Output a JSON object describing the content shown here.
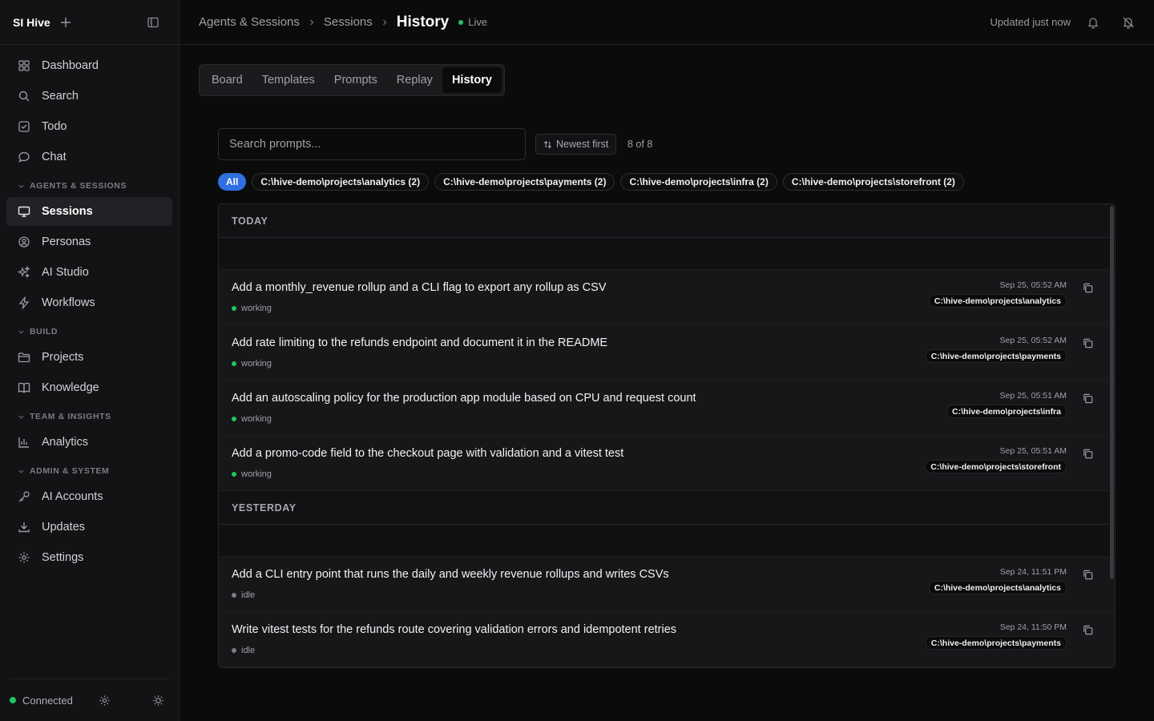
{
  "app": {
    "title": "SI Hive"
  },
  "sidebar": {
    "items_top": [
      {
        "label": "Dashboard",
        "icon": "dashboard-icon"
      },
      {
        "label": "Search",
        "icon": "search-icon"
      },
      {
        "label": "Todo",
        "icon": "todo-icon"
      },
      {
        "label": "Chat",
        "icon": "chat-icon"
      }
    ],
    "sections": [
      {
        "label": "AGENTS & SESSIONS",
        "items": [
          {
            "label": "Sessions",
            "icon": "monitor-icon",
            "active": true
          },
          {
            "label": "Personas",
            "icon": "persona-icon"
          },
          {
            "label": "AI Studio",
            "icon": "sparkles-icon"
          },
          {
            "label": "Workflows",
            "icon": "lightning-icon"
          }
        ]
      },
      {
        "label": "BUILD",
        "items": [
          {
            "label": "Projects",
            "icon": "folder-icon"
          },
          {
            "label": "Knowledge",
            "icon": "book-icon"
          }
        ]
      },
      {
        "label": "TEAM & INSIGHTS",
        "items": [
          {
            "label": "Analytics",
            "icon": "bar-chart-icon"
          }
        ]
      },
      {
        "label": "ADMIN & SYSTEM",
        "items": [
          {
            "label": "AI Accounts",
            "icon": "key-icon"
          },
          {
            "label": "Updates",
            "icon": "download-icon"
          },
          {
            "label": "Settings",
            "icon": "gear-icon"
          }
        ]
      }
    ],
    "footer": {
      "status": "Connected"
    }
  },
  "header": {
    "breadcrumbs": [
      "Agents & Sessions",
      "Sessions"
    ],
    "current": "History",
    "live": "Live",
    "updated": "Updated just now"
  },
  "tabs": [
    "Board",
    "Templates",
    "Prompts",
    "Replay",
    "History"
  ],
  "active_tab": "History",
  "search": {
    "placeholder": "Search prompts...",
    "value": ""
  },
  "sort": {
    "label": "Newest first"
  },
  "count": "8 of 8",
  "filters": [
    "All",
    "C:\\hive-demo\\projects\\analytics (2)",
    "C:\\hive-demo\\projects\\payments (2)",
    "C:\\hive-demo\\projects\\infra (2)",
    "C:\\hive-demo\\projects\\storefront (2)"
  ],
  "groups": [
    {
      "label": "TODAY",
      "rows": [
        {
          "title": "Add a monthly_revenue rollup and a CLI flag to export any rollup as CSV",
          "status": "working",
          "time": "Sep 25, 05:52 AM",
          "path": "C:\\hive-demo\\projects\\analytics"
        },
        {
          "title": "Add rate limiting to the refunds endpoint and document it in the README",
          "status": "working",
          "time": "Sep 25, 05:52 AM",
          "path": "C:\\hive-demo\\projects\\payments"
        },
        {
          "title": "Add an autoscaling policy for the production app module based on CPU and request count",
          "status": "working",
          "time": "Sep 25, 05:51 AM",
          "path": "C:\\hive-demo\\projects\\infra"
        },
        {
          "title": "Add a promo-code field to the checkout page with validation and a vitest test",
          "status": "working",
          "time": "Sep 25, 05:51 AM",
          "path": "C:\\hive-demo\\projects\\storefront"
        }
      ]
    },
    {
      "label": "YESTERDAY",
      "rows": [
        {
          "title": "Add a CLI entry point that runs the daily and weekly revenue rollups and writes CSVs",
          "status": "idle",
          "time": "Sep 24, 11:51 PM",
          "path": "C:\\hive-demo\\projects\\analytics"
        },
        {
          "title": "Write vitest tests for the refunds route covering validation errors and idempotent retries",
          "status": "idle",
          "time": "Sep 24, 11:50 PM",
          "path": "C:\\hive-demo\\projects\\payments"
        }
      ]
    }
  ],
  "colors": {
    "accent": "#2f6fe0",
    "status_working": "#22c55e",
    "status_idle": "#7c7c82"
  }
}
